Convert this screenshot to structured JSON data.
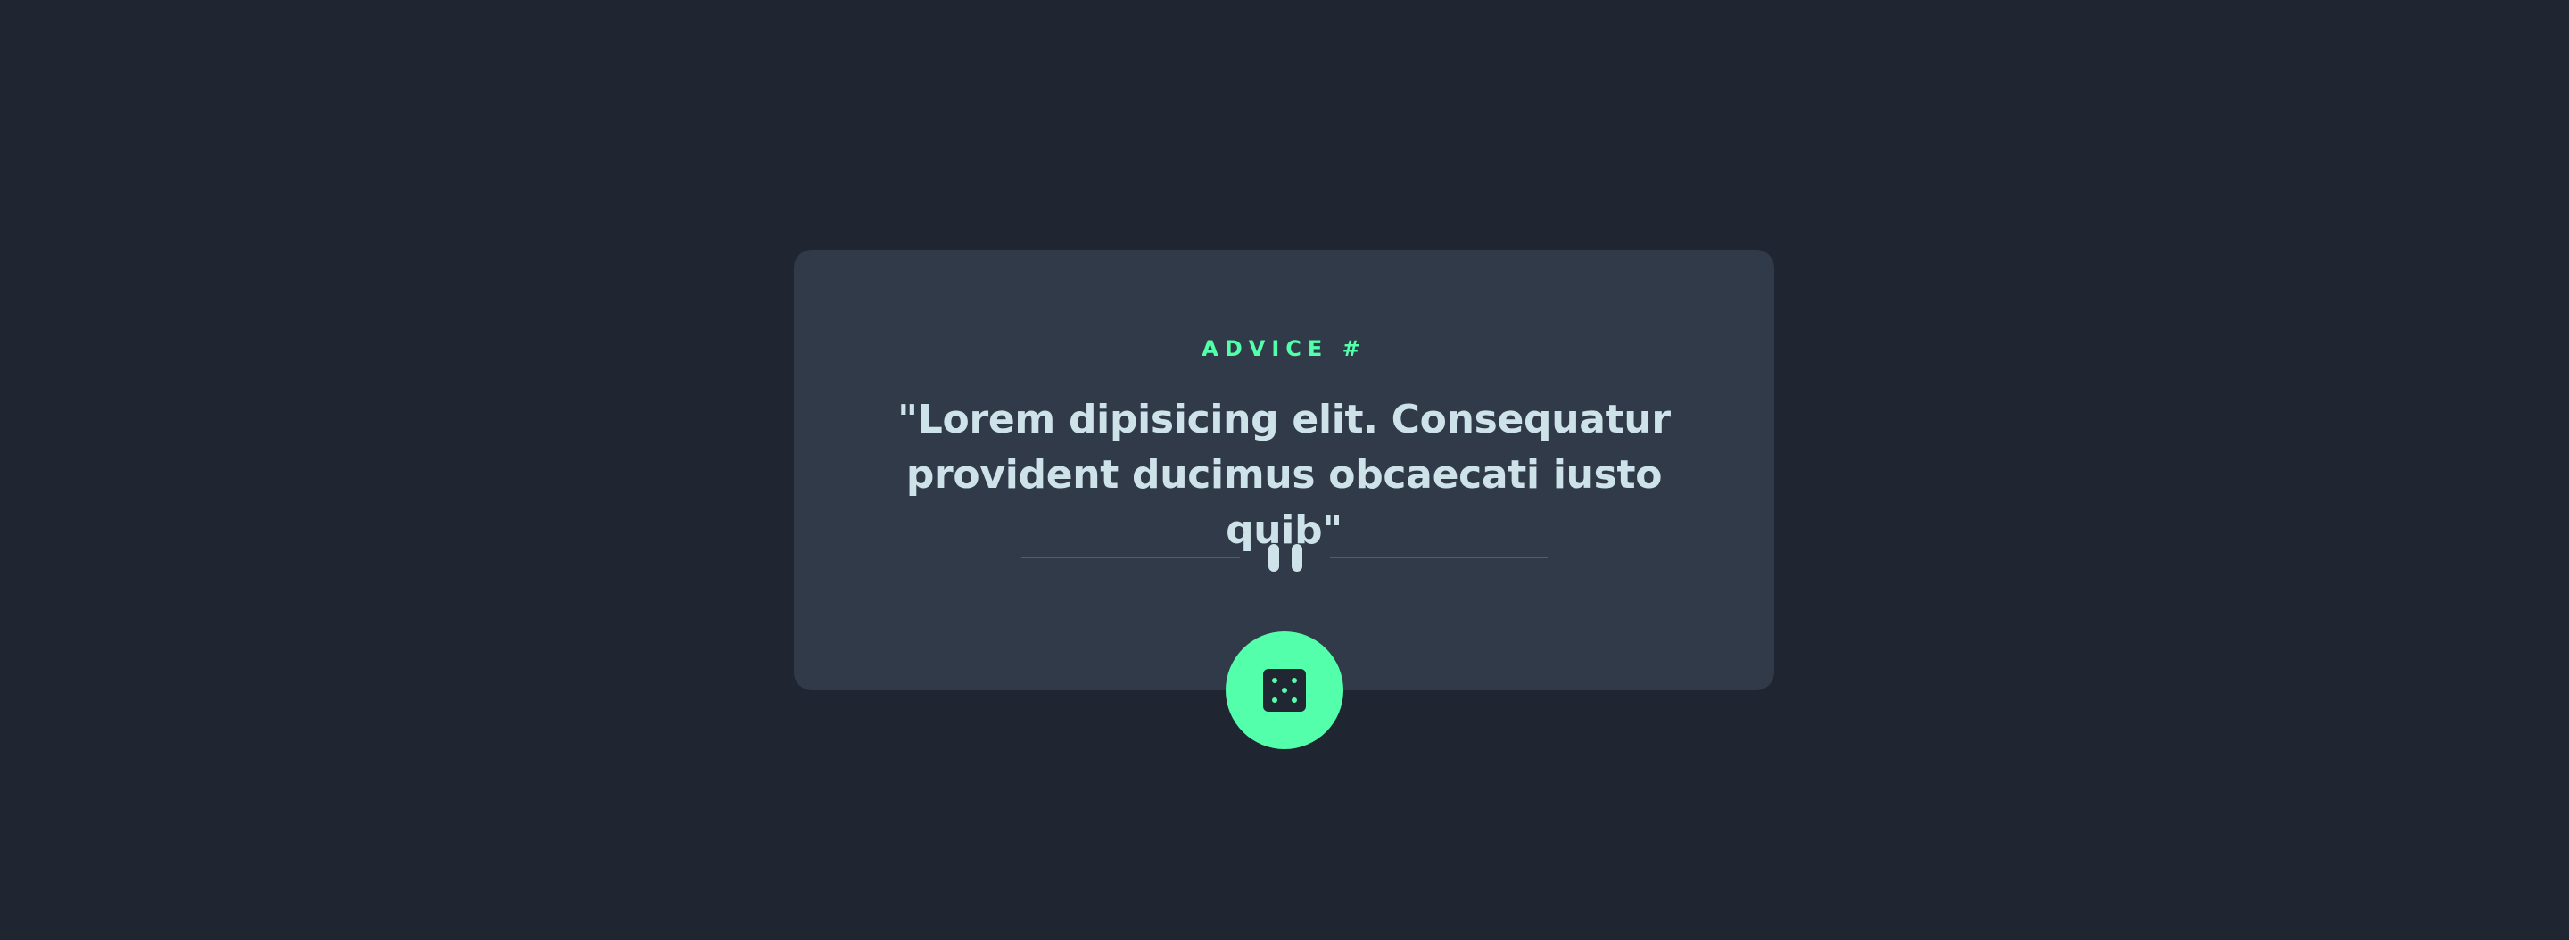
{
  "card": {
    "label": "ADVICE #",
    "quote": "\"Lorem dipisicing elit. Consequatur provident ducimus obcaecati iusto quib\""
  },
  "divider": {
    "icon": "pause-icon"
  },
  "button": {
    "icon": "dice-icon"
  },
  "colors": {
    "background": "#1f2632",
    "card": "#313a49",
    "accent": "#53ffaa",
    "text": "#cee3e9",
    "divider": "#4f5d74"
  }
}
